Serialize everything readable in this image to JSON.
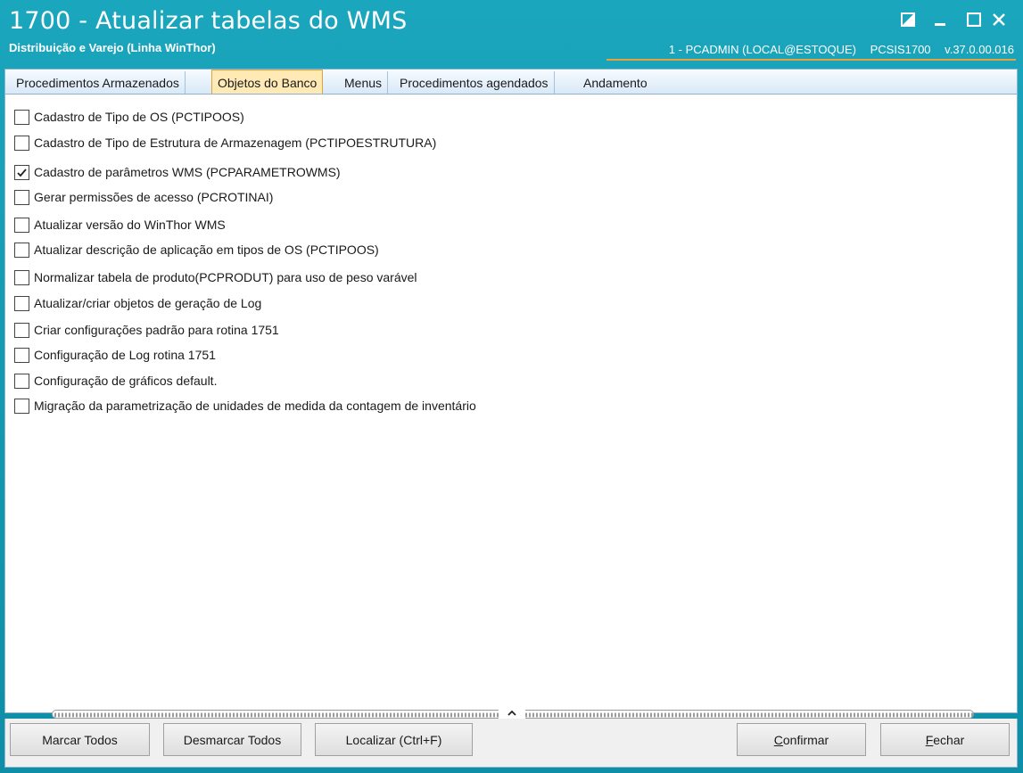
{
  "window": {
    "title": "1700 - Atualizar tabelas do WMS",
    "subtitle": "Distribuição e Varejo (Linha WinThor)",
    "user": "1 - PCADMIN (LOCAL@ESTOQUE)",
    "program": "PCSIS1700",
    "version": "v.37.0.00.016",
    "accent_color": "#0f8fa6"
  },
  "tabs": [
    {
      "label": "Procedimentos Armazenados"
    },
    {
      "label": "Objetos do Banco"
    },
    {
      "label": "Menus"
    },
    {
      "label": "Procedimentos agendados"
    },
    {
      "label": "Andamento"
    }
  ],
  "active_tab": "Objetos do Banco",
  "items": [
    {
      "label": "Cadastro de Tipo de OS (PCTIPOOS)",
      "checked": false
    },
    {
      "label": "Cadastro de Tipo de Estrutura de Armazenagem (PCTIPOESTRUTURA)",
      "checked": false
    },
    {
      "label": "Cadastro de parâmetros WMS (PCPARAMETROWMS)",
      "checked": true
    },
    {
      "label": "Gerar permissões de acesso (PCROTINAI)",
      "checked": false
    },
    {
      "label": "Atualizar versão do WinThor WMS",
      "checked": false
    },
    {
      "label": "Atualizar descrição de aplicação em tipos de OS (PCTIPOOS)",
      "checked": false
    },
    {
      "label": "Normalizar tabela de produto(PCPRODUT) para uso de peso varável",
      "checked": false
    },
    {
      "label": "Atualizar/criar objetos de geração de Log",
      "checked": false
    },
    {
      "label": "Criar configurações padrão para rotina 1751",
      "checked": false
    },
    {
      "label": "Configuração de Log rotina 1751",
      "checked": false
    },
    {
      "label": "Configuração de gráficos default.",
      "checked": false
    },
    {
      "label": "Migração da parametrização de unidades de medida da contagem de inventário",
      "checked": false
    }
  ],
  "buttons": {
    "mark_all": "Marcar Todos",
    "unmark_all": "Desmarcar Todos",
    "find": "Localizar (Ctrl+F)",
    "confirm_u": "C",
    "confirm_rest": "onfirmar",
    "close_u": "F",
    "close_rest": "echar"
  }
}
